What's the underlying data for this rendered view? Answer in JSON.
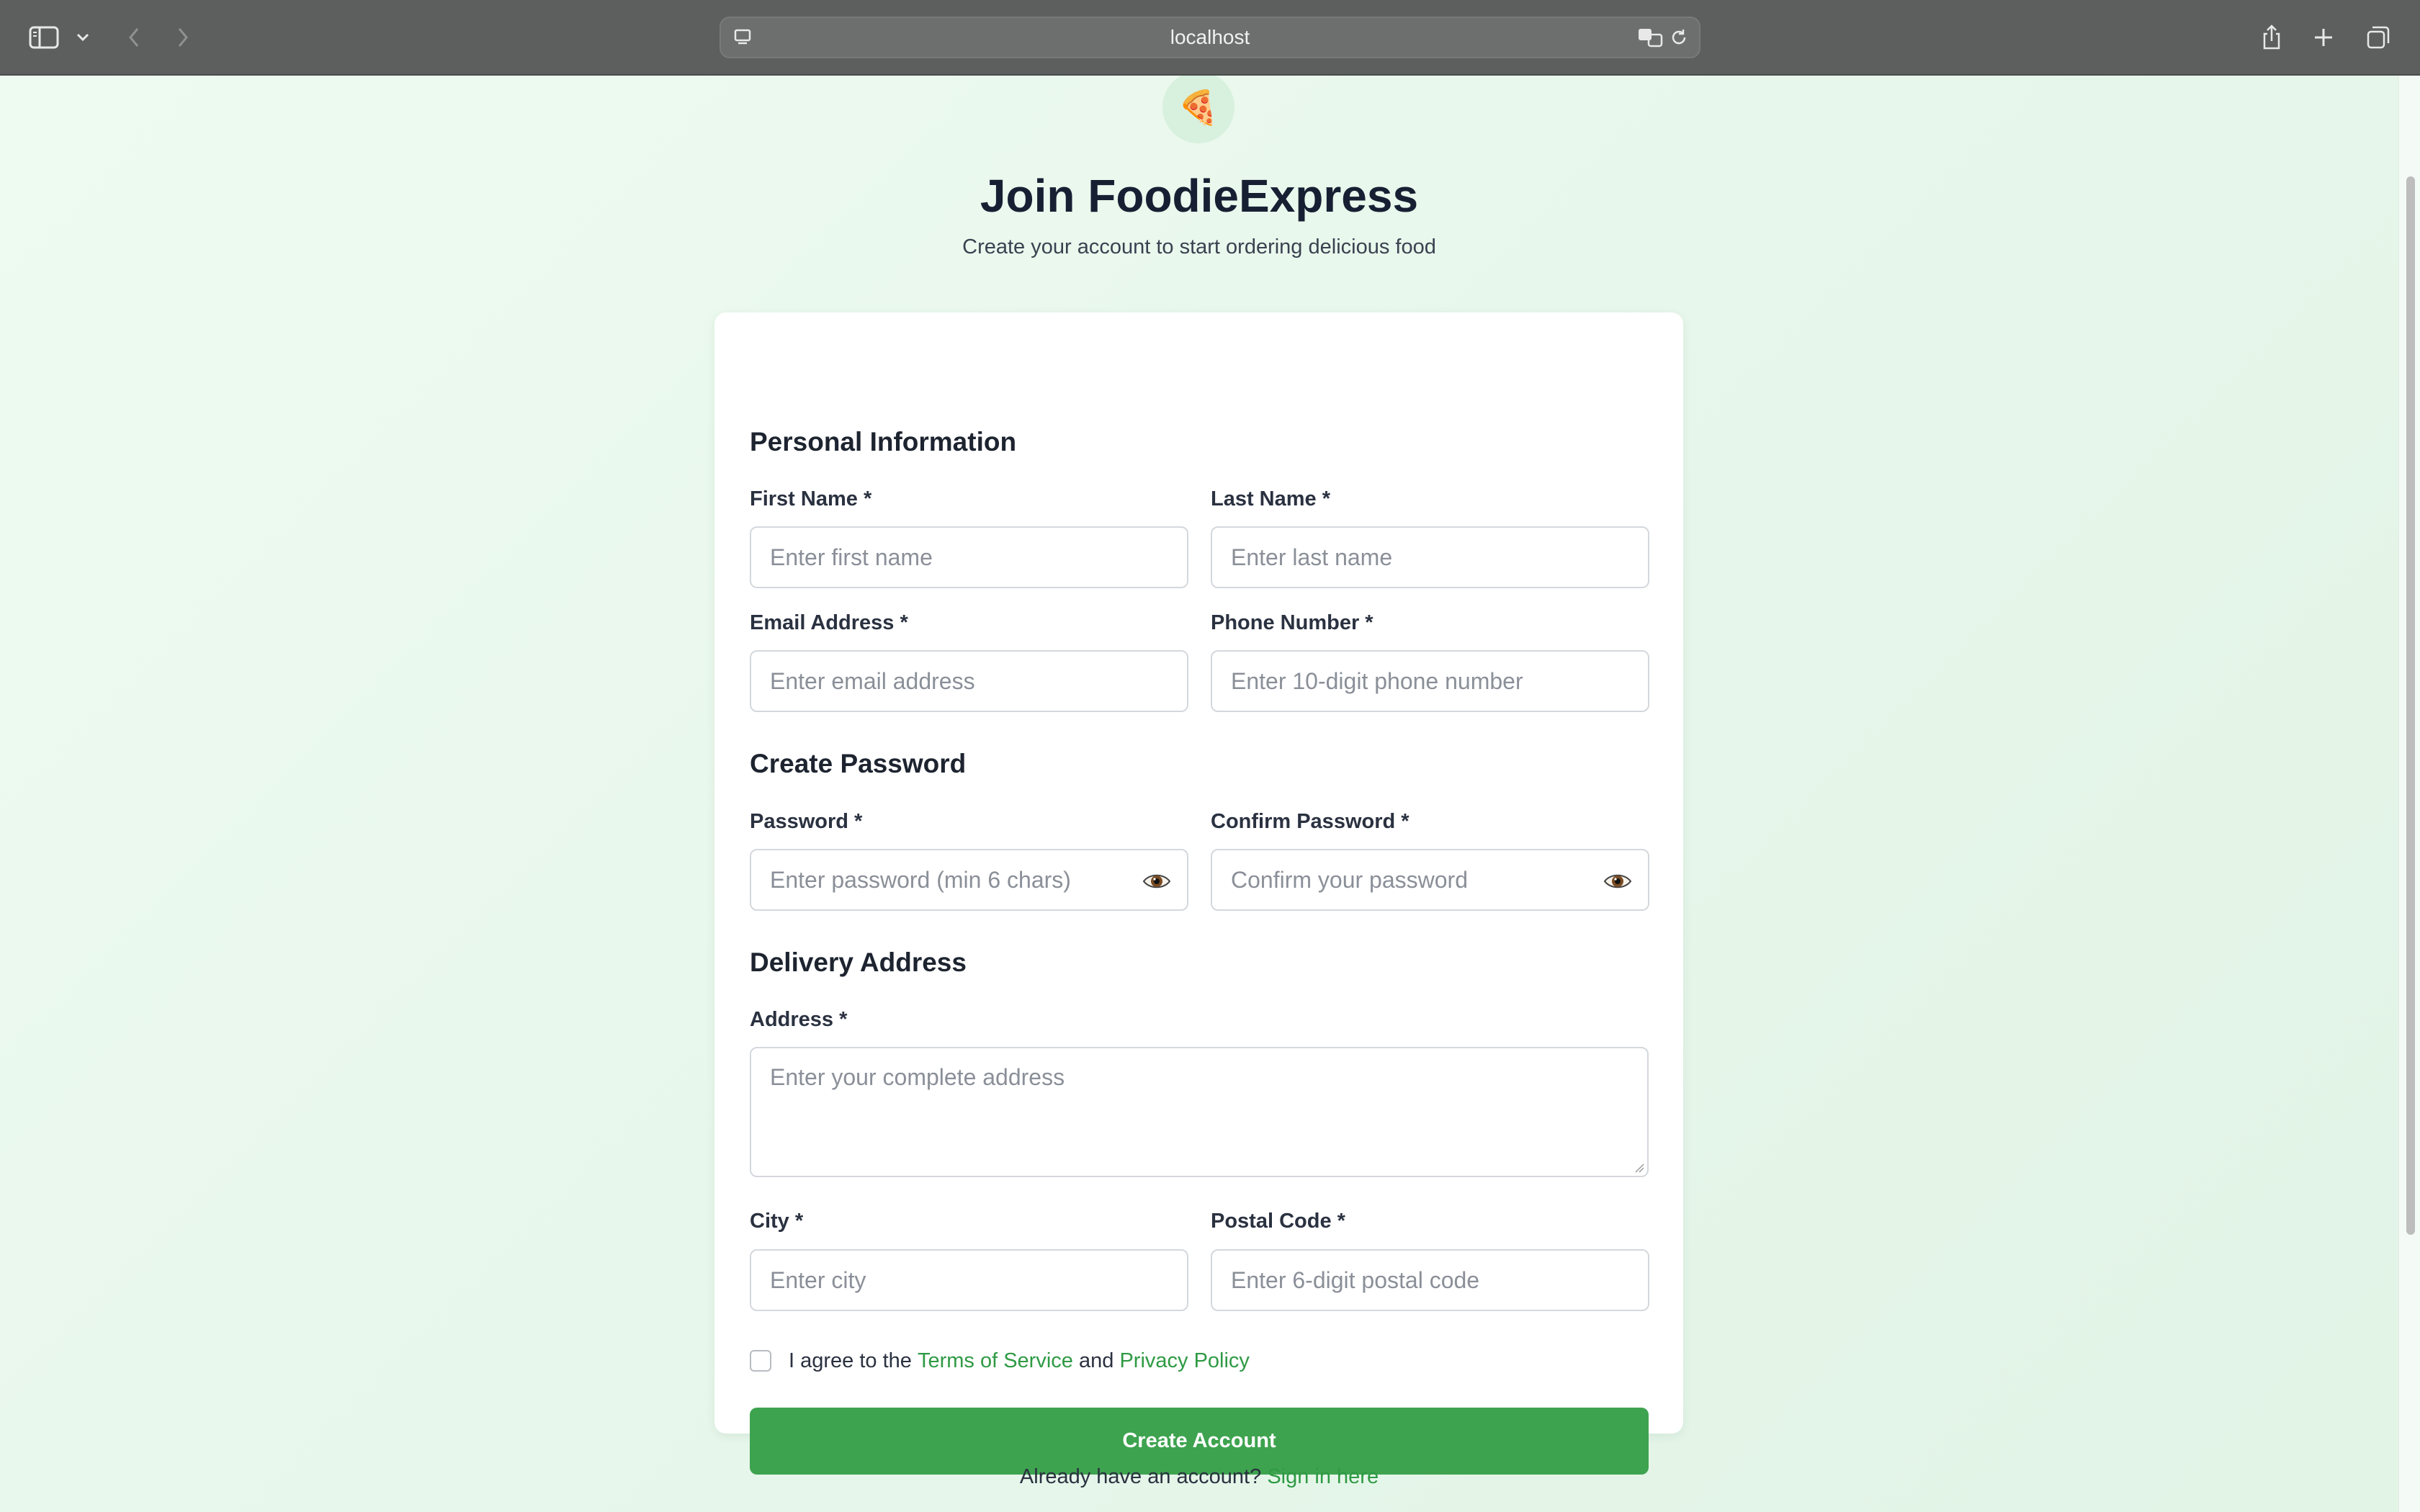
{
  "browser": {
    "url": "localhost"
  },
  "header": {
    "logo_emoji": "🍕",
    "title": "Join FoodieExpress",
    "subtitle": "Create your account to start ordering delicious food"
  },
  "sections": {
    "personal": "Personal Information",
    "password": "Create Password",
    "delivery": "Delivery Address"
  },
  "fields": {
    "first_name": {
      "label": "First Name *",
      "placeholder": "Enter first name",
      "value": ""
    },
    "last_name": {
      "label": "Last Name *",
      "placeholder": "Enter last name",
      "value": ""
    },
    "email": {
      "label": "Email Address *",
      "placeholder": "Enter email address",
      "value": ""
    },
    "phone": {
      "label": "Phone Number *",
      "placeholder": "Enter 10-digit phone number",
      "value": ""
    },
    "password": {
      "label": "Password *",
      "placeholder": "Enter password (min 6 chars)",
      "value": ""
    },
    "confirm_password": {
      "label": "Confirm Password *",
      "placeholder": "Confirm your password",
      "value": ""
    },
    "address": {
      "label": "Address *",
      "placeholder": "Enter your complete address",
      "value": ""
    },
    "city": {
      "label": "City *",
      "placeholder": "Enter city",
      "value": ""
    },
    "postal_code": {
      "label": "Postal Code *",
      "placeholder": "Enter 6-digit postal code",
      "value": ""
    }
  },
  "agreement": {
    "prefix": "I agree to the",
    "terms": "Terms of Service",
    "and": "and",
    "privacy": "Privacy Policy",
    "checked": false
  },
  "submit_label": "Create Account",
  "footer": {
    "prompt": "Already have an account?",
    "link": "Sign in here"
  },
  "colors": {
    "accent": "#3ea34f",
    "link": "#2f9a44",
    "background": "#eaf7ee"
  }
}
